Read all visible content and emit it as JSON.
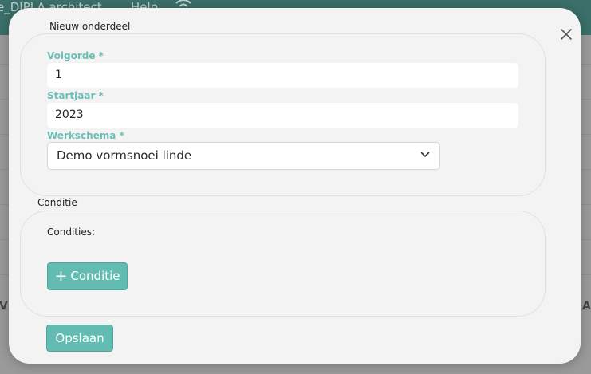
{
  "background": {
    "brand": "e_DIPLA architect",
    "help": "Help",
    "wifi_icon": "wifi-icon",
    "edge_left": "V",
    "edge_right": "A"
  },
  "modal": {
    "title": "Nieuw onderdeel",
    "close_icon": "close-icon",
    "fields": {
      "volgorde": {
        "label": "Volgorde *",
        "value": "1"
      },
      "startjaar": {
        "label": "Startjaar *",
        "value": "2023"
      },
      "werkschema": {
        "label": "Werkschema *",
        "selected": "Demo vormsnoei linde"
      }
    },
    "conditie": {
      "title": "Conditie",
      "list_label": "Condities:",
      "add_button": "Conditie"
    },
    "save_button": "Opslaan"
  },
  "colors": {
    "accent": "#62bcb2",
    "label_accent": "#6cbfb5",
    "header": "#3b6f69",
    "modal_bg": "#f3f3f3"
  }
}
